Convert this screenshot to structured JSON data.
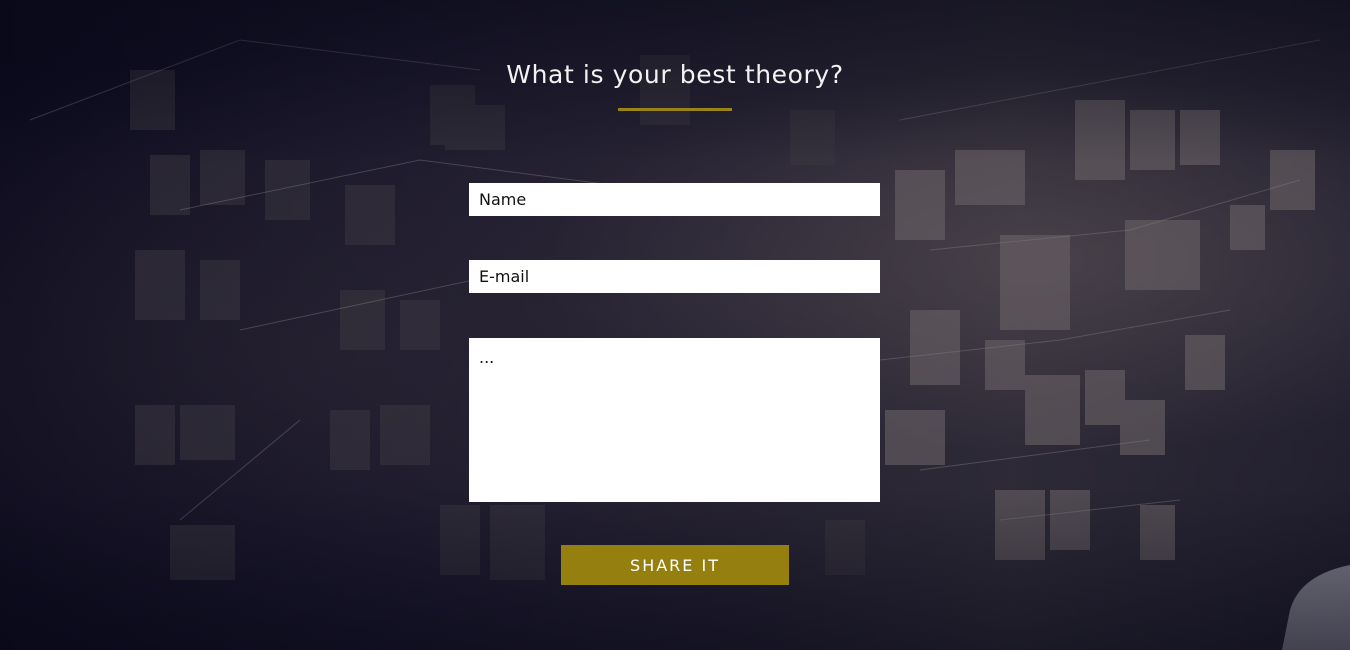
{
  "form": {
    "title": "What is your best theory?",
    "name_placeholder": "Name",
    "email_placeholder": "E-mail",
    "message_placeholder": "...",
    "submit_label": "SHARE IT"
  },
  "colors": {
    "accent": "#95800f",
    "background": "#0d0c1f",
    "heading_text": "#f2f2f2"
  }
}
